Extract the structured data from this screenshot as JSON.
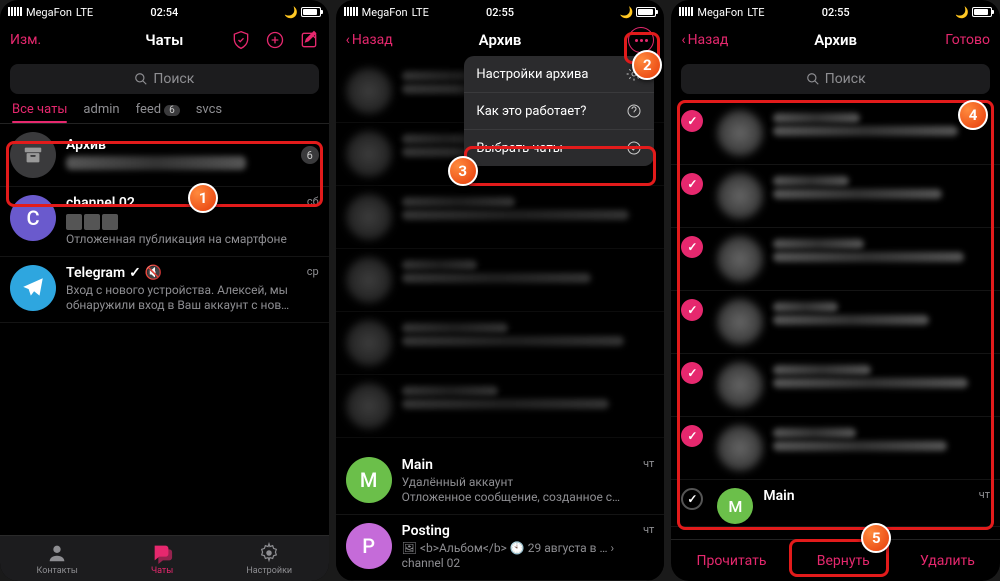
{
  "status": {
    "carrier": "MegaFon",
    "net": "LTE",
    "time1": "02:54",
    "time2": "02:55",
    "time3": "02:55"
  },
  "screen1": {
    "edit": "Изм.",
    "title": "Чаты",
    "search": "Поиск",
    "tabs": {
      "all": "Все чаты",
      "admin": "admin",
      "feed": "feed",
      "feed_badge": "6",
      "svcs": "svcs"
    },
    "archive": {
      "title": "Архив",
      "count": "6"
    },
    "chat1": {
      "title": "channel 02",
      "time": "сб",
      "sub": "Отложенная публикация на смартфоне"
    },
    "chat2": {
      "title": "Telegram",
      "time": "ср",
      "sub": "Вход с нового устройства. Алексей, мы обнаружили вход в Ваш аккаунт с нов…"
    },
    "tab_contacts": "Контакты",
    "tab_chats": "Чаты",
    "tab_settings": "Настройки"
  },
  "screen2": {
    "back": "Назад",
    "title": "Архив",
    "menu": {
      "settings": "Настройки архива",
      "how": "Как это работает?",
      "select": "Выбрать чаты"
    },
    "chat1": {
      "title": "Main",
      "time": "чт",
      "sub1": "Удалённый аккаунт",
      "sub2": "Отложенное сообщение, созданное с…"
    },
    "chat2": {
      "title": "Posting",
      "time": "чт",
      "sub": "🖼 <b>Альбом</b> 🕙 29 августа в …  › channel 02"
    }
  },
  "screen3": {
    "back": "Назад",
    "title": "Архив",
    "done": "Готово",
    "search": "Поиск",
    "main": "Main",
    "time": "чт",
    "actions": {
      "read": "Прочитать",
      "return": "Вернуть",
      "delete": "Удалить"
    }
  }
}
